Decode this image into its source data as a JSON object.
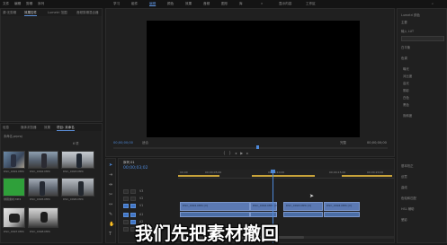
{
  "menubar": {
    "items": [
      "文件",
      "编辑",
      "剪辑",
      "序列",
      "标记",
      "图形",
      "视图",
      "窗口",
      "帮助"
    ],
    "workspaces": [
      "学习",
      "组件",
      "编辑",
      "颜色",
      "效果",
      "音频",
      "图形",
      "库"
    ],
    "active_workspace": "编辑",
    "right_items": [
      "显示内容",
      "工作区"
    ]
  },
  "source_panel": {
    "tabs": [
      "源·无剪辑",
      "效果控件",
      "Lumetri 范围",
      "音频剪辑混合器"
    ]
  },
  "program_monitor": {
    "title": "节目: 序列 01",
    "timecode_in": "00;00;00;00",
    "fit": "适合",
    "quality": "完整",
    "timecode_out": "00;00;00;00"
  },
  "project_panel": {
    "tabs": [
      "项目: 未命名",
      "媒体浏览器",
      "库",
      "信息",
      "效果"
    ],
    "active_tab": "项目: 未命名",
    "file": "未命名.prproj",
    "count": "6 项",
    "thumbnails": [
      {
        "name": "DSC_0091.MP4",
        "dur": "8:17"
      },
      {
        "name": "DSC_0092.MP4",
        "dur": "6:02"
      },
      {
        "name": "DSC_0093.MP4",
        "dur": "4:11"
      },
      {
        "name": "绿幕素材.MP4",
        "dur": "3:09"
      },
      {
        "name": "DSC_0095.MP4",
        "dur": "5:24"
      },
      {
        "name": "DSC_0096.MP4",
        "dur": "7:15"
      },
      {
        "name": "DSC_0097.MP4",
        "dur": "2:48"
      },
      {
        "name": "DSC_0098.MP4",
        "dur": "9:31"
      }
    ]
  },
  "timeline": {
    "tab": "序列 01",
    "timecode": "00;00;03;02",
    "ruler": [
      "00;00",
      "00;00;05;00",
      "00;00;10;00",
      "00;00;15;00",
      "00;00;20;00"
    ],
    "tracks": [
      "V3",
      "V2",
      "V1",
      "A1",
      "A2",
      "A3"
    ],
    "clips": [
      {
        "label": "DSC_0091.MP4 [V]"
      },
      {
        "label": "DSC_0092.MP4 [V]"
      },
      {
        "label": "DSC_0093.MP4 [V]"
      },
      {
        "label": "DSC_0094.MP4 [V]"
      }
    ]
  },
  "right_panel": {
    "sections": [
      "基本校正",
      "创意",
      "曲线",
      "色轮和匹配",
      "HSL 辅助",
      "晕影"
    ],
    "labels": [
      "Lumetri 颜色",
      "主要",
      "输入 LUT",
      "白平衡",
      "色调",
      "曝光",
      "对比度",
      "高光",
      "阴影",
      "白色",
      "黑色",
      "饱和度"
    ]
  },
  "subtitle": "我们先把素材撤回",
  "colors": {
    "accent": "#4d88d8",
    "clip": "#5b79b3",
    "playhead": "#4d88d8"
  }
}
